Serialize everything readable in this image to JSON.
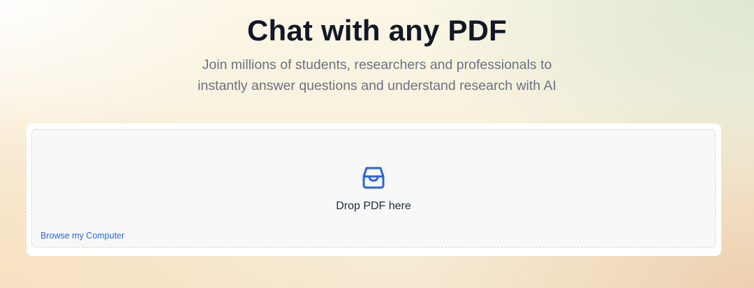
{
  "hero": {
    "title": "Chat with any PDF",
    "subtitle_line1": "Join millions of students, researchers and professionals to",
    "subtitle_line2": "instantly answer questions and understand research with AI"
  },
  "upload": {
    "icon": "inbox-icon",
    "drop_label": "Drop PDF here",
    "browse_label": "Browse my Computer"
  },
  "colors": {
    "accent": "#2563eb",
    "title": "#111827",
    "subtitle": "#6b7280"
  }
}
